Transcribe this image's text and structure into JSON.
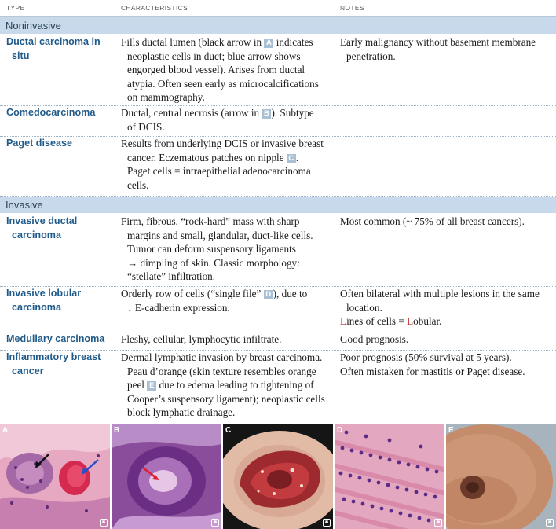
{
  "header": {
    "col_type": "TYPE",
    "col_characteristics": "CHARACTERISTICS",
    "col_notes": "NOTES"
  },
  "sections": {
    "noninvasive": "Noninvasive",
    "invasive": "Invasive"
  },
  "rows": {
    "dcis": {
      "name_1": "Ductal carcinoma in",
      "name_2": "situ",
      "char_1a": "Fills ductal lumen (black arrow in ",
      "char_1_ref": "A",
      "char_1b": " indicates",
      "char_2": "neoplastic cells in duct; blue arrow shows",
      "char_3": "engorged blood vessel). Arises from ductal",
      "char_4": "atypia. Often seen early as microcalcifications",
      "char_5": "on mammography.",
      "note_1": "Early malignancy without basement membrane",
      "note_2": "penetration."
    },
    "comedo": {
      "name_1": "Comedocarcinoma",
      "char_1a": "Ductal, central necrosis (arrow in ",
      "char_1_ref": "B",
      "char_1b": "). Subtype",
      "char_2": "of DCIS."
    },
    "paget": {
      "name_1": "Paget disease",
      "char_1": "Results from underlying DCIS or invasive breast",
      "char_2a": "cancer. Eczematous patches on nipple ",
      "char_2_ref": "C",
      "char_2b": ".",
      "char_3": "Paget cells = intraepithelial adenocarcinoma",
      "char_4": "cells."
    },
    "idc": {
      "name_1": "Invasive ductal",
      "name_2": "carcinoma",
      "char_1": "Firm, fibrous, “rock-hard” mass with sharp",
      "char_2": "margins and small, glandular, duct-like cells.",
      "char_3": "Tumor can deform suspensory ligaments",
      "char_4": "→ dimpling of skin. Classic morphology:",
      "char_5": "“stellate” infiltration.",
      "note_1": "Most common (~ 75% of all breast cancers)."
    },
    "ilc": {
      "name_1": "Invasive lobular",
      "name_2": "carcinoma",
      "char_1a": "Orderly row of cells (“single file” ",
      "char_1_ref": "D",
      "char_1b": "), due to",
      "char_2": "↓ E-cadherin expression.",
      "note_1": "Often bilateral with multiple lesions in the same",
      "note_2": "location.",
      "note_3_L1": "L",
      "note_3_mid": "ines of cells = ",
      "note_3_L2": "L",
      "note_3_end": "obular."
    },
    "medullary": {
      "name_1": "Medullary carcinoma",
      "char_1": "Fleshy, cellular, lymphocytic infiltrate.",
      "note_1": "Good prognosis."
    },
    "inflammatory": {
      "name_1": "Inflammatory breast",
      "name_2": "cancer",
      "char_1": "Dermal lymphatic invasion by breast carcinoma.",
      "char_2": "Peau d’orange (skin texture resembles orange",
      "char_3a": "peel ",
      "char_3_ref": "E",
      "char_3b": " due to edema leading to tightening of",
      "char_4": "Cooper’s suspensory ligament); neoplastic cells",
      "char_5": "block lymphatic drainage.",
      "note_1": "Poor prognosis (50% survival at 5 years).",
      "note_2": "Often mistaken for mastitis or Paget disease."
    }
  },
  "photos": [
    {
      "label": "A",
      "desc_icon": "histology-dcis-image"
    },
    {
      "label": "B",
      "desc_icon": "histology-comedo-image"
    },
    {
      "label": "C",
      "desc_icon": "paget-nipple-photo"
    },
    {
      "label": "D",
      "desc_icon": "histology-lobular-image"
    },
    {
      "label": "E",
      "desc_icon": "peau-dorange-photo"
    }
  ],
  "colors": {
    "section_band": "#c7d9ea",
    "type_text": "#1f5a8a",
    "ref_box": "#a9bfd3",
    "highlight_red": "#c0262d"
  }
}
